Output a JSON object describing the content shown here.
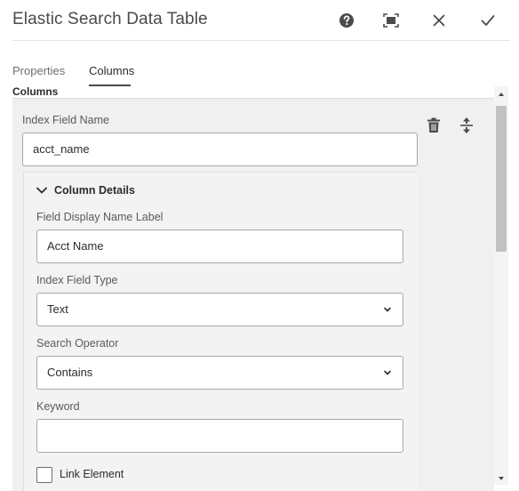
{
  "dialog": {
    "title": "Elastic Search Data Table",
    "help_icon": "help-icon",
    "fullscreen_icon": "fullscreen-icon",
    "close_icon": "close-icon",
    "done_icon": "check-icon"
  },
  "tabs": [
    {
      "label": "Properties",
      "active": false
    },
    {
      "label": "Columns",
      "active": true
    }
  ],
  "columns": {
    "section_label": "Columns",
    "item": {
      "index_field_name_label": "Index Field Name",
      "index_field_name_value": "acct_name",
      "delete_icon": "trash-icon",
      "reorder_icon": "move-vertical-icon",
      "details": {
        "header": "Column Details",
        "expanded": true,
        "display_name_label": "Field Display Name Label",
        "display_name_value": "Acct Name",
        "field_type_label": "Index Field Type",
        "field_type_value": "Text",
        "operator_label": "Search Operator",
        "operator_value": "Contains",
        "keyword_label": "Keyword",
        "keyword_value": "",
        "link_element_label": "Link Element",
        "link_element_checked": false
      }
    }
  },
  "colors": {
    "panel_bg": "#f0f0f0",
    "tab_underline": "#4b4b4b",
    "input_border": "#a8a8a8"
  }
}
